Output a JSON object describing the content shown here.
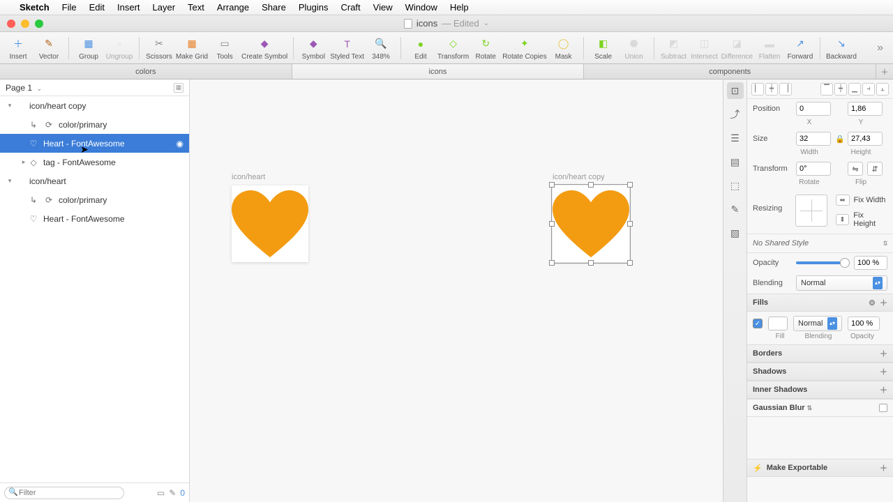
{
  "menubar": {
    "app": "Sketch",
    "items": [
      "File",
      "Edit",
      "Insert",
      "Layer",
      "Text",
      "Arrange",
      "Share",
      "Plugins",
      "Craft",
      "View",
      "Window",
      "Help"
    ]
  },
  "titlebar": {
    "docname": "icons",
    "edited": "— Edited"
  },
  "toolbar": {
    "items": [
      {
        "label": "Insert",
        "icon": "＋",
        "color": "#4a90e2"
      },
      {
        "label": "Vector",
        "icon": "✎",
        "color": "#b5651d"
      },
      {
        "label": "Group",
        "icon": "▦",
        "color": "#4a90e2"
      },
      {
        "label": "Ungroup",
        "icon": "▫",
        "color": "#bbb",
        "dim": true
      },
      {
        "label": "Scissors",
        "icon": "✂",
        "color": "#888"
      },
      {
        "label": "Make Grid",
        "icon": "▦",
        "color": "#e67e22"
      },
      {
        "label": "Tools",
        "icon": "▭",
        "color": "#888"
      },
      {
        "label": "Create Symbol",
        "icon": "◆",
        "color": "#9b59b6"
      },
      {
        "label": "Symbol",
        "icon": "◆",
        "color": "#9b59b6"
      },
      {
        "label": "Styled Text",
        "icon": "T",
        "color": "#9b59b6"
      },
      {
        "label": "348%",
        "icon": "🔍",
        "color": "#666"
      },
      {
        "label": "Edit",
        "icon": "●",
        "color": "#7ed321"
      },
      {
        "label": "Transform",
        "icon": "◇",
        "color": "#7ed321"
      },
      {
        "label": "Rotate",
        "icon": "↻",
        "color": "#7ed321"
      },
      {
        "label": "Rotate Copies",
        "icon": "✦",
        "color": "#7ed321"
      },
      {
        "label": "Mask",
        "icon": "◯",
        "color": "#e6c84a"
      },
      {
        "label": "Scale",
        "icon": "◧",
        "color": "#7ed321"
      },
      {
        "label": "Union",
        "icon": "⬣",
        "color": "#bbb",
        "dim": true
      },
      {
        "label": "Subtract",
        "icon": "◩",
        "color": "#bbb",
        "dim": true
      },
      {
        "label": "Intersect",
        "icon": "◫",
        "color": "#bbb",
        "dim": true
      },
      {
        "label": "Difference",
        "icon": "◪",
        "color": "#bbb",
        "dim": true
      },
      {
        "label": "Flatten",
        "icon": "▬",
        "color": "#bbb",
        "dim": true
      },
      {
        "label": "Forward",
        "icon": "↗",
        "color": "#4a90e2"
      },
      {
        "label": "Backward",
        "icon": "↘",
        "color": "#4a90e2"
      }
    ]
  },
  "pagetabs": {
    "tabs": [
      "colors",
      "icons",
      "components"
    ],
    "active": 1
  },
  "leftpanel": {
    "page_label": "Page 1",
    "layers": [
      {
        "ind": 0,
        "disc": "▾",
        "icon": "",
        "name": "icon/heart copy"
      },
      {
        "ind": 1,
        "disc": "",
        "icon": "⟳",
        "name": "color/primary",
        "preicon": "↳"
      },
      {
        "ind": 1,
        "disc": "",
        "icon": "♡",
        "name": "Heart - FontAwesome",
        "sel": true,
        "eye": "◉"
      },
      {
        "ind": 1,
        "disc": "▸",
        "icon": "◇",
        "name": "tag - FontAwesome"
      },
      {
        "ind": 0,
        "disc": "▾",
        "icon": "",
        "name": "icon/heart"
      },
      {
        "ind": 1,
        "disc": "",
        "icon": "⟳",
        "name": "color/primary",
        "preicon": "↳"
      },
      {
        "ind": 1,
        "disc": "",
        "icon": "♡",
        "name": "Heart - FontAwesome"
      }
    ],
    "filter_placeholder": "Filter",
    "filter_count": "0"
  },
  "canvas": {
    "artboards": [
      {
        "label": "icon/heart",
        "selected": false
      },
      {
        "label": "icon/heart copy",
        "selected": true
      }
    ],
    "heart_color": "#f39c12"
  },
  "inspector": {
    "position_label": "Position",
    "pos_x": "0",
    "pos_y": "1,86",
    "x_label": "X",
    "y_label": "Y",
    "size_label": "Size",
    "size_w": "32",
    "size_h": "27,43",
    "w_label": "Width",
    "h_label": "Height",
    "transform_label": "Transform",
    "rotate_val": "0°",
    "rotate_label": "Rotate",
    "flip_label": "Flip",
    "resizing_label": "Resizing",
    "fix_width": "Fix Width",
    "fix_height": "Fix Height",
    "shared_style": "No Shared Style",
    "opacity_label": "Opacity",
    "opacity_val": "100 %",
    "blending_label": "Blending",
    "blending_val": "Normal",
    "fills_label": "Fills",
    "fill_blend": "Normal",
    "fill_opacity": "100 %",
    "fill_sub": "Fill",
    "blend_sub": "Blending",
    "opac_sub": "Opacity",
    "borders_label": "Borders",
    "shadows_label": "Shadows",
    "inner_shadows_label": "Inner Shadows",
    "blur_label": "Gaussian Blur",
    "export_label": "Make Exportable"
  }
}
